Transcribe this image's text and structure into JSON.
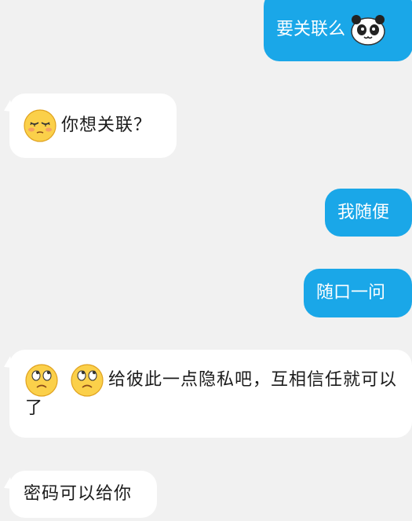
{
  "messages": [
    {
      "side": "sent",
      "text": "要关联么",
      "emoji": "panda-icon"
    },
    {
      "side": "received",
      "text": "你想关联？",
      "emoji": "sleepy-face-icon"
    },
    {
      "side": "sent",
      "text": "我随便"
    },
    {
      "side": "sent",
      "text": "随口一问"
    },
    {
      "side": "received",
      "text": "给彼此一点隐私吧，互相信任就可以了",
      "emoji": "eye-roll-face-icon"
    },
    {
      "side": "received",
      "text": "密码可以给你"
    }
  ],
  "colors": {
    "background": "#f1f1f1",
    "sent_bubble": "#1aa7e8",
    "received_bubble": "#ffffff"
  }
}
